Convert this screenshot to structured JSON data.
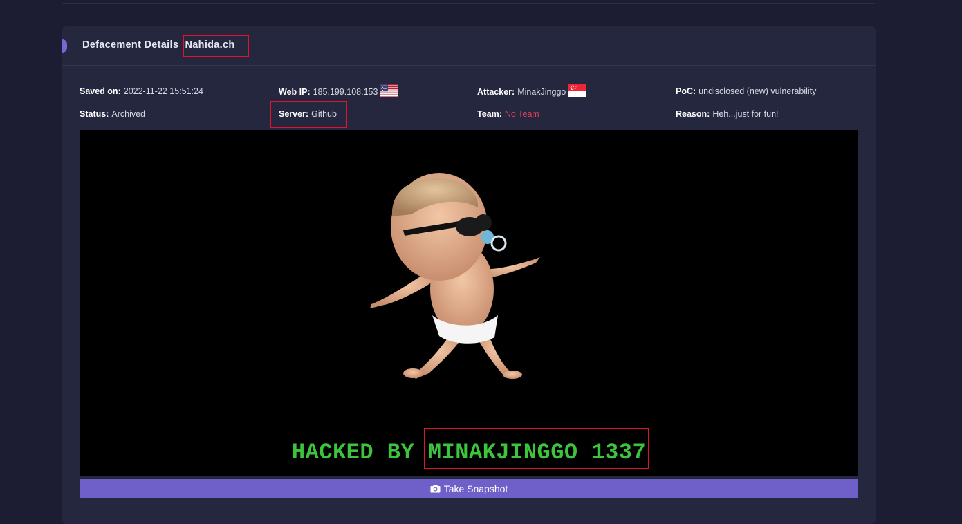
{
  "card": {
    "title": "Defacement Details",
    "site": "Nahida.ch"
  },
  "details": {
    "saved_on_label": "Saved on:",
    "saved_on": "2022-11-22 15:51:24",
    "status_label": "Status:",
    "status": "Archived",
    "web_ip_label": "Web IP:",
    "web_ip": "185.199.108.153",
    "web_ip_flag": "us-flag-icon",
    "server_label": "Server:",
    "server": "Github",
    "attacker_label": "Attacker:",
    "attacker": "MinakJinggo",
    "attacker_flag": "sg-flag-icon",
    "team_label": "Team:",
    "team": "No Team",
    "poc_label": "PoC:",
    "poc": "undisclosed (new) vulnerability",
    "reason_label": "Reason:",
    "reason": "Heh...just for fun!"
  },
  "preview": {
    "hacked_prefix": "HACKED BY",
    "hacked_by": "MINAKJINGGO 1337"
  },
  "snapshot": {
    "label": "Take Snapshot",
    "icon": "camera-icon"
  },
  "colors": {
    "background": "#1c1d33",
    "card": "#25273f",
    "accent": "#6f5fc8",
    "highlight_box": "#e0142c",
    "hacked_text": "#3cc43c",
    "team_text": "#e0404f"
  }
}
